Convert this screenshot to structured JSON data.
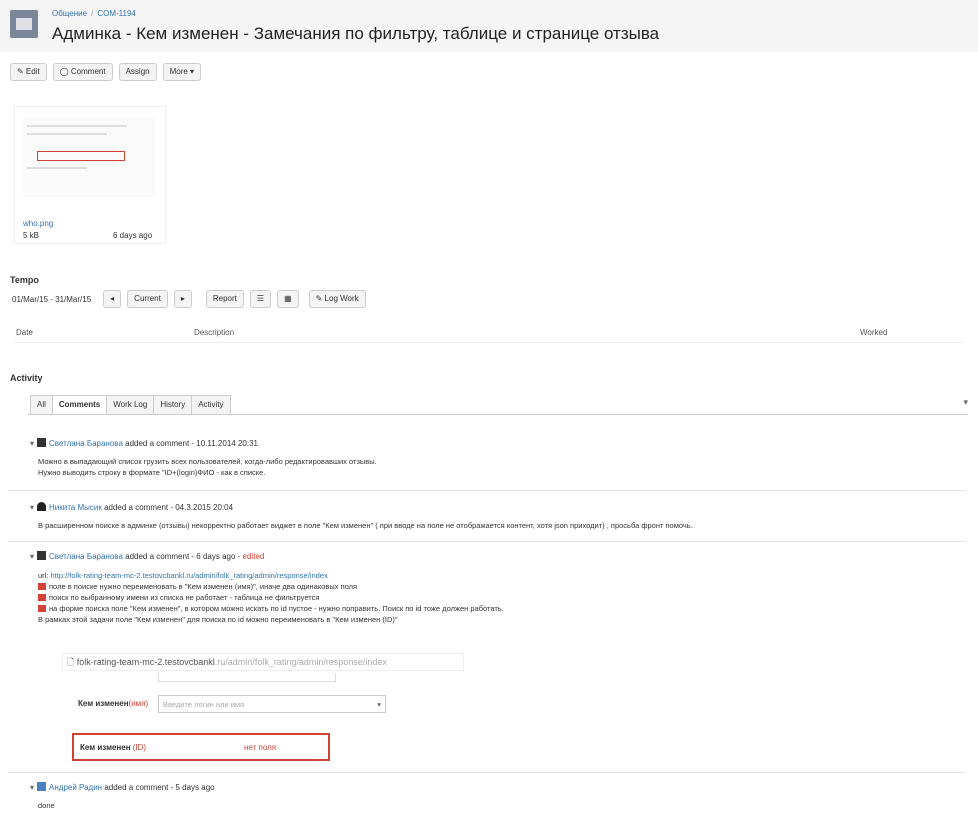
{
  "header": {
    "breadcrumb": [
      "Общение",
      "COM-1194"
    ],
    "title": "Админка - Кем изменен - Замечания по фильтру, таблице и странице отзыва"
  },
  "toolbar": {
    "edit": "✎ Edit",
    "comment": "◯ Comment",
    "assign": "Assign",
    "more": "More ▾"
  },
  "attachment": {
    "name": "who.png",
    "size": "5 kB",
    "date": "6 days ago"
  },
  "tempo": {
    "heading": "Tempo",
    "range": "01/Mar/15 - 31/Mar/15",
    "prev": "◂",
    "current": "Current",
    "next": "▸",
    "report": "Report",
    "log_work": "✎ Log Work",
    "columns": [
      "Date",
      "Description",
      "Worked"
    ]
  },
  "activity": {
    "heading": "Activity",
    "tabs": [
      "All",
      "Comments",
      "Work Log",
      "History",
      "Activity"
    ],
    "active_tab": "Comments",
    "comments": [
      {
        "author": "Светлана Баранова",
        "meta": " added a comment - 10.11.2014 20:31",
        "lines": [
          "Можно в выпадающий список грузить всех пользователей, когда-либо редактировавших отзывы.",
          "Нужно выводить строку в формате \"ID+(login)ФИО - как в списке."
        ]
      },
      {
        "author": "Никита Мысик",
        "meta": " added a comment - 04.3.2015 20:04",
        "lines": [
          "В расширенном поиске в админке (отзывы) некорректно работает виджет в поле \"Кем изменен\" ( при вводе на поле не отображается контент, хотя json приходит) , просьба фронт помочь."
        ]
      },
      {
        "author": "Светлана Баранова",
        "meta": " added a comment - 6 days ago - ",
        "edited": "edited",
        "url_prefix": "url: ",
        "url": "http://folk-rating-team-mc-2.testovcbankl.ru/admin/folk_rating/admin/response/index",
        "items": [
          "поле в поиске нужно переименовать в \"Кем изменен (имя)\", иначе два одинаковых поля",
          "поиск по выбранному имени из списка не работает - таблица не фильтруется",
          "на форме поиска поле \"Кем изменен\", в котором можно искать по id пустое - нужно поправить. Поиск по id тоже должен работать."
        ],
        "note": "В рамках этой задачи поле \"Кем изменен\" для поиска по id можно переименовать в \"Кем изменен (ID)\"",
        "embed": {
          "url_dark": "folk-rating-team-mc-2.testovcbankl",
          "url_dim": ".ru/admin/folk_rating/admin/response/index",
          "field_label": "Кем изменен",
          "field_opt": "(имя)",
          "select_placeholder": "Введите логин или имя",
          "id_label": "Кем изменен ",
          "id_suffix": "(ID)",
          "missing": "нет поля"
        }
      },
      {
        "author": "Андрей Радин",
        "meta": " added a comment - 5 days ago",
        "lines": [
          "done"
        ]
      }
    ]
  },
  "colors": {
    "link": "#3572b0",
    "danger": "#d04437"
  }
}
